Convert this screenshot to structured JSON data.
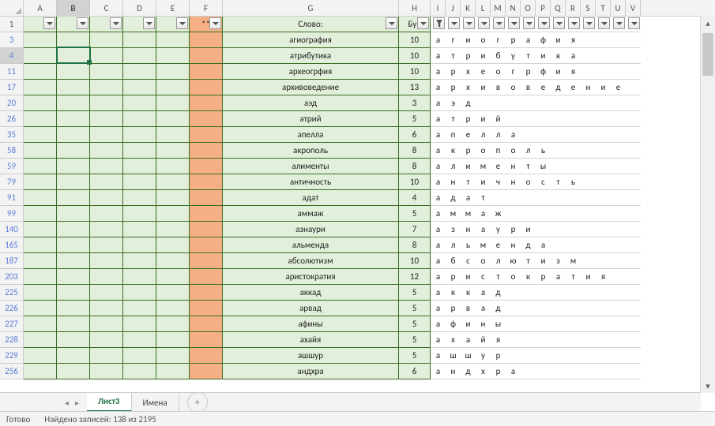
{
  "columnLetters": [
    "A",
    "B",
    "C",
    "D",
    "E",
    "F",
    "G",
    "H",
    "I",
    "J",
    "K",
    "L",
    "M",
    "N",
    "O",
    "P",
    "Q",
    "R",
    "S",
    "T",
    "U",
    "V"
  ],
  "colWidths": {
    "row": 30,
    "A": 42,
    "B": 42,
    "C": 42,
    "D": 42,
    "E": 42,
    "F": 42,
    "G": 223,
    "H": 40,
    "letter": 19
  },
  "headerCells": {
    "F": "**",
    "G": "Слово:",
    "H": "Бук"
  },
  "rows": [
    {
      "n": 3,
      "word": "агиография",
      "len": 10,
      "letters": [
        "а",
        "г",
        "и",
        "о",
        "г",
        "р",
        "а",
        "ф",
        "и",
        "я"
      ]
    },
    {
      "n": 4,
      "word": "атрибутика",
      "len": 10,
      "letters": [
        "а",
        "т",
        "р",
        "и",
        "б",
        "у",
        "т",
        "и",
        "к",
        "а"
      ]
    },
    {
      "n": 11,
      "word": "археогрфия",
      "len": 10,
      "letters": [
        "а",
        "р",
        "х",
        "е",
        "о",
        "г",
        "р",
        "ф",
        "и",
        "я"
      ]
    },
    {
      "n": 17,
      "word": "архивоведение",
      "len": 13,
      "letters": [
        "а",
        "р",
        "х",
        "и",
        "в",
        "о",
        "в",
        "е",
        "д",
        "е",
        "н",
        "и",
        "е"
      ]
    },
    {
      "n": 20,
      "word": "аэд",
      "len": 3,
      "letters": [
        "а",
        "э",
        "д"
      ]
    },
    {
      "n": 26,
      "word": "атрий",
      "len": 5,
      "letters": [
        "а",
        "т",
        "р",
        "и",
        "й"
      ]
    },
    {
      "n": 35,
      "word": "апелла",
      "len": 6,
      "letters": [
        "а",
        "п",
        "е",
        "л",
        "л",
        "а"
      ]
    },
    {
      "n": 58,
      "word": "акрополь",
      "len": 8,
      "letters": [
        "а",
        "к",
        "р",
        "о",
        "п",
        "о",
        "л",
        "ь"
      ]
    },
    {
      "n": 59,
      "word": "алименты",
      "len": 8,
      "letters": [
        "а",
        "л",
        "и",
        "м",
        "е",
        "н",
        "т",
        "ы"
      ]
    },
    {
      "n": 79,
      "word": "античность",
      "len": 10,
      "letters": [
        "а",
        "н",
        "т",
        "и",
        "ч",
        "н",
        "о",
        "с",
        "т",
        "ь"
      ]
    },
    {
      "n": 91,
      "word": "адат",
      "len": 4,
      "letters": [
        "а",
        "д",
        "а",
        "т"
      ]
    },
    {
      "n": 99,
      "word": "аммаж",
      "len": 5,
      "letters": [
        "а",
        "м",
        "м",
        "а",
        "ж"
      ]
    },
    {
      "n": 140,
      "word": "азнаури",
      "len": 7,
      "letters": [
        "а",
        "з",
        "н",
        "а",
        "у",
        "р",
        "и"
      ]
    },
    {
      "n": 165,
      "word": "альменда",
      "len": 8,
      "letters": [
        "а",
        "л",
        "ь",
        "м",
        "е",
        "н",
        "д",
        "а"
      ]
    },
    {
      "n": 187,
      "word": "абсолютизм",
      "len": 10,
      "letters": [
        "а",
        "б",
        "с",
        "о",
        "л",
        "ю",
        "т",
        "и",
        "з",
        "м"
      ]
    },
    {
      "n": 203,
      "word": "аристократия",
      "len": 12,
      "letters": [
        "а",
        "р",
        "и",
        "с",
        "т",
        "о",
        "к",
        "р",
        "а",
        "т",
        "и",
        "я"
      ]
    },
    {
      "n": 225,
      "word": "аккад",
      "len": 5,
      "letters": [
        "а",
        "к",
        "к",
        "а",
        "д"
      ]
    },
    {
      "n": 226,
      "word": "арвад",
      "len": 5,
      "letters": [
        "а",
        "р",
        "в",
        "а",
        "д"
      ]
    },
    {
      "n": 227,
      "word": "афины",
      "len": 5,
      "letters": [
        "а",
        "ф",
        "и",
        "н",
        "ы"
      ]
    },
    {
      "n": 228,
      "word": "ахайя",
      "len": 5,
      "letters": [
        "а",
        "х",
        "а",
        "й",
        "я"
      ]
    },
    {
      "n": 229,
      "word": "ашшур",
      "len": 5,
      "letters": [
        "а",
        "ш",
        "ш",
        "у",
        "р"
      ]
    },
    {
      "n": 256,
      "word": "андхра",
      "len": 6,
      "letters": [
        "а",
        "н",
        "д",
        "х",
        "р",
        "а"
      ]
    }
  ],
  "activeCell": {
    "col": "B",
    "rowIndex": 1
  },
  "tabs": {
    "active": "Лист3",
    "other": "Имена"
  },
  "status": {
    "ready": "Готово",
    "found": "Найдено записей: 138 из 2195"
  },
  "filteredCol": "I"
}
